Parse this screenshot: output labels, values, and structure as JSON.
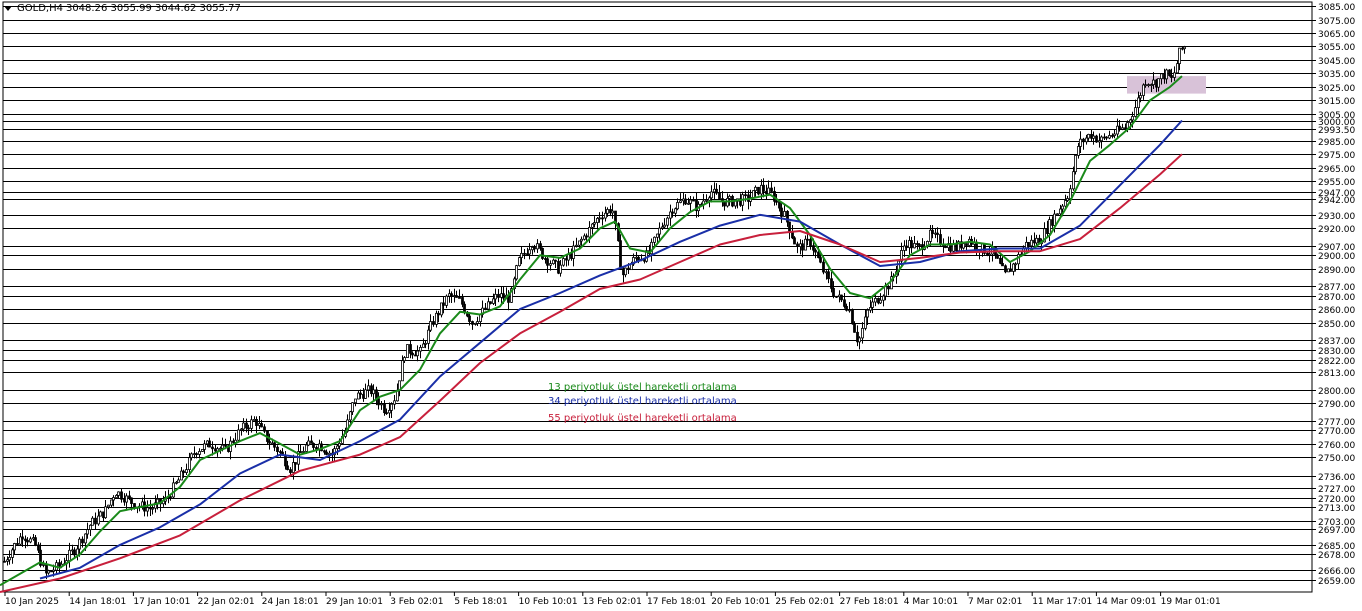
{
  "header": {
    "symbol": "GOLD,H4",
    "ohlc": "3048.26 3055.99 3044.62 3055.77"
  },
  "legend": [
    {
      "label": "13 periyotluk üstel hareketli ortalama",
      "color": "#1a8a1a"
    },
    {
      "label": "34 periyotluk üstel hareketli ortalama",
      "color": "#1a2fa8"
    },
    {
      "label": "55 periyotluk üstel hareketli ortalama",
      "color": "#c8203c"
    }
  ],
  "colors": {
    "background": "#ffffff",
    "candle": "#000000",
    "level_line": "#000000",
    "zone": "#d8c2d8"
  },
  "chart_data": {
    "type": "candlestick",
    "symbol": "GOLD",
    "timeframe": "H4",
    "ylim": [
      2650,
      3088
    ],
    "x_tick_labels": [
      "10 Jan 2025",
      "14 Jan 18:01",
      "17 Jan 10:01",
      "22 Jan 02:01",
      "24 Jan 18:01",
      "29 Jan 10:01",
      "3 Feb 02:01",
      "5 Feb 18:01",
      "10 Feb 10:01",
      "13 Feb 02:01",
      "17 Feb 18:01",
      "20 Feb 10:01",
      "25 Feb 02:01",
      "27 Feb 18:01",
      "4 Mar 10:01",
      "7 Mar 02:01",
      "11 Mar 17:01",
      "14 Mar 09:01",
      "19 Mar 01:01"
    ],
    "price_levels": [
      "3085.00",
      "3075.00",
      "3065.00",
      "3055.00",
      "3045.00",
      "3035.00",
      "3025.00",
      "3015.00",
      "3005.00",
      "3000.00",
      "2993.50",
      "2985.00",
      "2975.00",
      "2965.00",
      "2955.00",
      "2947.00",
      "2942.00",
      "2930.00",
      "2920.00",
      "2907.00",
      "2900.00",
      "2890.00",
      "2877.00",
      "2870.00",
      "2860.00",
      "2850.00",
      "2837.00",
      "2830.00",
      "2822.00",
      "2813.00",
      "2800.00",
      "2790.00",
      "2777.00",
      "2770.00",
      "2760.00",
      "2750.00",
      "2736.00",
      "2727.00",
      "2720.00",
      "2713.00",
      "2703.00",
      "2697.00",
      "2685.00",
      "2678.00",
      "2666.00",
      "2659.00"
    ],
    "price_path": [
      {
        "x": 0,
        "y": 2668
      },
      {
        "x": 10,
        "y": 2680
      },
      {
        "x": 22,
        "y": 2693
      },
      {
        "x": 35,
        "y": 2685
      },
      {
        "x": 45,
        "y": 2663
      },
      {
        "x": 60,
        "y": 2670
      },
      {
        "x": 75,
        "y": 2682
      },
      {
        "x": 90,
        "y": 2700
      },
      {
        "x": 105,
        "y": 2710
      },
      {
        "x": 115,
        "y": 2725
      },
      {
        "x": 125,
        "y": 2720
      },
      {
        "x": 135,
        "y": 2715
      },
      {
        "x": 150,
        "y": 2712
      },
      {
        "x": 165,
        "y": 2718
      },
      {
        "x": 180,
        "y": 2735
      },
      {
        "x": 195,
        "y": 2755
      },
      {
        "x": 210,
        "y": 2760
      },
      {
        "x": 225,
        "y": 2755
      },
      {
        "x": 240,
        "y": 2770
      },
      {
        "x": 255,
        "y": 2778
      },
      {
        "x": 265,
        "y": 2765
      },
      {
        "x": 278,
        "y": 2755
      },
      {
        "x": 290,
        "y": 2742
      },
      {
        "x": 305,
        "y": 2758
      },
      {
        "x": 318,
        "y": 2760
      },
      {
        "x": 332,
        "y": 2752
      },
      {
        "x": 345,
        "y": 2770
      },
      {
        "x": 355,
        "y": 2795
      },
      {
        "x": 370,
        "y": 2800
      },
      {
        "x": 385,
        "y": 2785
      },
      {
        "x": 395,
        "y": 2795
      },
      {
        "x": 405,
        "y": 2830
      },
      {
        "x": 420,
        "y": 2828
      },
      {
        "x": 432,
        "y": 2850
      },
      {
        "x": 448,
        "y": 2870
      },
      {
        "x": 460,
        "y": 2866
      },
      {
        "x": 472,
        "y": 2850
      },
      {
        "x": 485,
        "y": 2860
      },
      {
        "x": 497,
        "y": 2870
      },
      {
        "x": 510,
        "y": 2868
      },
      {
        "x": 518,
        "y": 2895
      },
      {
        "x": 532,
        "y": 2910
      },
      {
        "x": 545,
        "y": 2898
      },
      {
        "x": 558,
        "y": 2890
      },
      {
        "x": 570,
        "y": 2900
      },
      {
        "x": 585,
        "y": 2915
      },
      {
        "x": 600,
        "y": 2930
      },
      {
        "x": 612,
        "y": 2935
      },
      {
        "x": 622,
        "y": 2885
      },
      {
        "x": 635,
        "y": 2898
      },
      {
        "x": 648,
        "y": 2900
      },
      {
        "x": 660,
        "y": 2920
      },
      {
        "x": 672,
        "y": 2935
      },
      {
        "x": 685,
        "y": 2942
      },
      {
        "x": 698,
        "y": 2935
      },
      {
        "x": 710,
        "y": 2948
      },
      {
        "x": 722,
        "y": 2940
      },
      {
        "x": 735,
        "y": 2940
      },
      {
        "x": 748,
        "y": 2942
      },
      {
        "x": 760,
        "y": 2950
      },
      {
        "x": 772,
        "y": 2945
      },
      {
        "x": 785,
        "y": 2928
      },
      {
        "x": 797,
        "y": 2905
      },
      {
        "x": 810,
        "y": 2910
      },
      {
        "x": 822,
        "y": 2890
      },
      {
        "x": 835,
        "y": 2870
      },
      {
        "x": 848,
        "y": 2862
      },
      {
        "x": 858,
        "y": 2835
      },
      {
        "x": 868,
        "y": 2860
      },
      {
        "x": 880,
        "y": 2870
      },
      {
        "x": 892,
        "y": 2882
      },
      {
        "x": 905,
        "y": 2910
      },
      {
        "x": 918,
        "y": 2905
      },
      {
        "x": 930,
        "y": 2915
      },
      {
        "x": 942,
        "y": 2910
      },
      {
        "x": 955,
        "y": 2905
      },
      {
        "x": 968,
        "y": 2912
      },
      {
        "x": 980,
        "y": 2905
      },
      {
        "x": 992,
        "y": 2902
      },
      {
        "x": 1005,
        "y": 2885
      },
      {
        "x": 1015,
        "y": 2895
      },
      {
        "x": 1025,
        "y": 2908
      },
      {
        "x": 1040,
        "y": 2912
      },
      {
        "x": 1055,
        "y": 2930
      },
      {
        "x": 1068,
        "y": 2945
      },
      {
        "x": 1078,
        "y": 2982
      },
      {
        "x": 1090,
        "y": 2990
      },
      {
        "x": 1100,
        "y": 2985
      },
      {
        "x": 1112,
        "y": 2990
      },
      {
        "x": 1125,
        "y": 2995
      },
      {
        "x": 1135,
        "y": 3010
      },
      {
        "x": 1145,
        "y": 3030
      },
      {
        "x": 1155,
        "y": 3028
      },
      {
        "x": 1165,
        "y": 3035
      },
      {
        "x": 1172,
        "y": 3030
      },
      {
        "x": 1180,
        "y": 3052
      },
      {
        "x": 1185,
        "y": 3055
      }
    ],
    "ema": [
      {
        "period": 13,
        "color": "#1a8a1a",
        "points": [
          {
            "x": 0,
            "y": 2655
          },
          {
            "x": 40,
            "y": 2672
          },
          {
            "x": 60,
            "y": 2668
          },
          {
            "x": 80,
            "y": 2678
          },
          {
            "x": 100,
            "y": 2695
          },
          {
            "x": 120,
            "y": 2710
          },
          {
            "x": 140,
            "y": 2713
          },
          {
            "x": 160,
            "y": 2716
          },
          {
            "x": 180,
            "y": 2728
          },
          {
            "x": 200,
            "y": 2748
          },
          {
            "x": 220,
            "y": 2755
          },
          {
            "x": 240,
            "y": 2762
          },
          {
            "x": 260,
            "y": 2768
          },
          {
            "x": 280,
            "y": 2760
          },
          {
            "x": 300,
            "y": 2752
          },
          {
            "x": 320,
            "y": 2756
          },
          {
            "x": 340,
            "y": 2762
          },
          {
            "x": 360,
            "y": 2785
          },
          {
            "x": 380,
            "y": 2795
          },
          {
            "x": 400,
            "y": 2800
          },
          {
            "x": 420,
            "y": 2815
          },
          {
            "x": 440,
            "y": 2842
          },
          {
            "x": 460,
            "y": 2858
          },
          {
            "x": 480,
            "y": 2856
          },
          {
            "x": 500,
            "y": 2862
          },
          {
            "x": 520,
            "y": 2882
          },
          {
            "x": 540,
            "y": 2900
          },
          {
            "x": 560,
            "y": 2898
          },
          {
            "x": 580,
            "y": 2905
          },
          {
            "x": 600,
            "y": 2920
          },
          {
            "x": 615,
            "y": 2925
          },
          {
            "x": 630,
            "y": 2905
          },
          {
            "x": 650,
            "y": 2902
          },
          {
            "x": 670,
            "y": 2920
          },
          {
            "x": 690,
            "y": 2932
          },
          {
            "x": 710,
            "y": 2940
          },
          {
            "x": 730,
            "y": 2940
          },
          {
            "x": 750,
            "y": 2942
          },
          {
            "x": 770,
            "y": 2945
          },
          {
            "x": 790,
            "y": 2935
          },
          {
            "x": 810,
            "y": 2915
          },
          {
            "x": 830,
            "y": 2890
          },
          {
            "x": 850,
            "y": 2872
          },
          {
            "x": 870,
            "y": 2868
          },
          {
            "x": 890,
            "y": 2880
          },
          {
            "x": 910,
            "y": 2900
          },
          {
            "x": 930,
            "y": 2908
          },
          {
            "x": 950,
            "y": 2908
          },
          {
            "x": 970,
            "y": 2910
          },
          {
            "x": 990,
            "y": 2908
          },
          {
            "x": 1010,
            "y": 2895
          },
          {
            "x": 1030,
            "y": 2903
          },
          {
            "x": 1050,
            "y": 2915
          },
          {
            "x": 1070,
            "y": 2940
          },
          {
            "x": 1090,
            "y": 2970
          },
          {
            "x": 1110,
            "y": 2982
          },
          {
            "x": 1130,
            "y": 2995
          },
          {
            "x": 1150,
            "y": 3015
          },
          {
            "x": 1170,
            "y": 3025
          },
          {
            "x": 1182,
            "y": 3033
          }
        ]
      },
      {
        "period": 34,
        "color": "#1a2fa8",
        "points": [
          {
            "x": 40,
            "y": 2660
          },
          {
            "x": 80,
            "y": 2668
          },
          {
            "x": 120,
            "y": 2685
          },
          {
            "x": 160,
            "y": 2698
          },
          {
            "x": 200,
            "y": 2715
          },
          {
            "x": 240,
            "y": 2738
          },
          {
            "x": 280,
            "y": 2752
          },
          {
            "x": 320,
            "y": 2748
          },
          {
            "x": 360,
            "y": 2762
          },
          {
            "x": 400,
            "y": 2778
          },
          {
            "x": 440,
            "y": 2810
          },
          {
            "x": 480,
            "y": 2835
          },
          {
            "x": 520,
            "y": 2860
          },
          {
            "x": 560,
            "y": 2872
          },
          {
            "x": 600,
            "y": 2885
          },
          {
            "x": 640,
            "y": 2896
          },
          {
            "x": 680,
            "y": 2910
          },
          {
            "x": 720,
            "y": 2922
          },
          {
            "x": 760,
            "y": 2930
          },
          {
            "x": 800,
            "y": 2925
          },
          {
            "x": 840,
            "y": 2908
          },
          {
            "x": 880,
            "y": 2892
          },
          {
            "x": 920,
            "y": 2895
          },
          {
            "x": 960,
            "y": 2903
          },
          {
            "x": 1000,
            "y": 2905
          },
          {
            "x": 1040,
            "y": 2905
          },
          {
            "x": 1080,
            "y": 2922
          },
          {
            "x": 1120,
            "y": 2952
          },
          {
            "x": 1160,
            "y": 2982
          },
          {
            "x": 1182,
            "y": 3000
          }
        ]
      },
      {
        "period": 55,
        "color": "#c8203c",
        "points": [
          {
            "x": 0,
            "y": 2650
          },
          {
            "x": 60,
            "y": 2660
          },
          {
            "x": 120,
            "y": 2675
          },
          {
            "x": 180,
            "y": 2692
          },
          {
            "x": 240,
            "y": 2718
          },
          {
            "x": 300,
            "y": 2740
          },
          {
            "x": 360,
            "y": 2752
          },
          {
            "x": 400,
            "y": 2765
          },
          {
            "x": 440,
            "y": 2792
          },
          {
            "x": 480,
            "y": 2820
          },
          {
            "x": 520,
            "y": 2842
          },
          {
            "x": 560,
            "y": 2858
          },
          {
            "x": 600,
            "y": 2875
          },
          {
            "x": 640,
            "y": 2882
          },
          {
            "x": 680,
            "y": 2895
          },
          {
            "x": 720,
            "y": 2908
          },
          {
            "x": 760,
            "y": 2915
          },
          {
            "x": 800,
            "y": 2918
          },
          {
            "x": 840,
            "y": 2908
          },
          {
            "x": 880,
            "y": 2895
          },
          {
            "x": 920,
            "y": 2898
          },
          {
            "x": 960,
            "y": 2902
          },
          {
            "x": 1000,
            "y": 2903
          },
          {
            "x": 1040,
            "y": 2903
          },
          {
            "x": 1080,
            "y": 2912
          },
          {
            "x": 1120,
            "y": 2935
          },
          {
            "x": 1160,
            "y": 2960
          },
          {
            "x": 1182,
            "y": 2975
          }
        ]
      }
    ],
    "highlight_zone": {
      "x_start": 1127,
      "x_end": 1206,
      "y_low": 3020,
      "y_high": 3033
    }
  }
}
